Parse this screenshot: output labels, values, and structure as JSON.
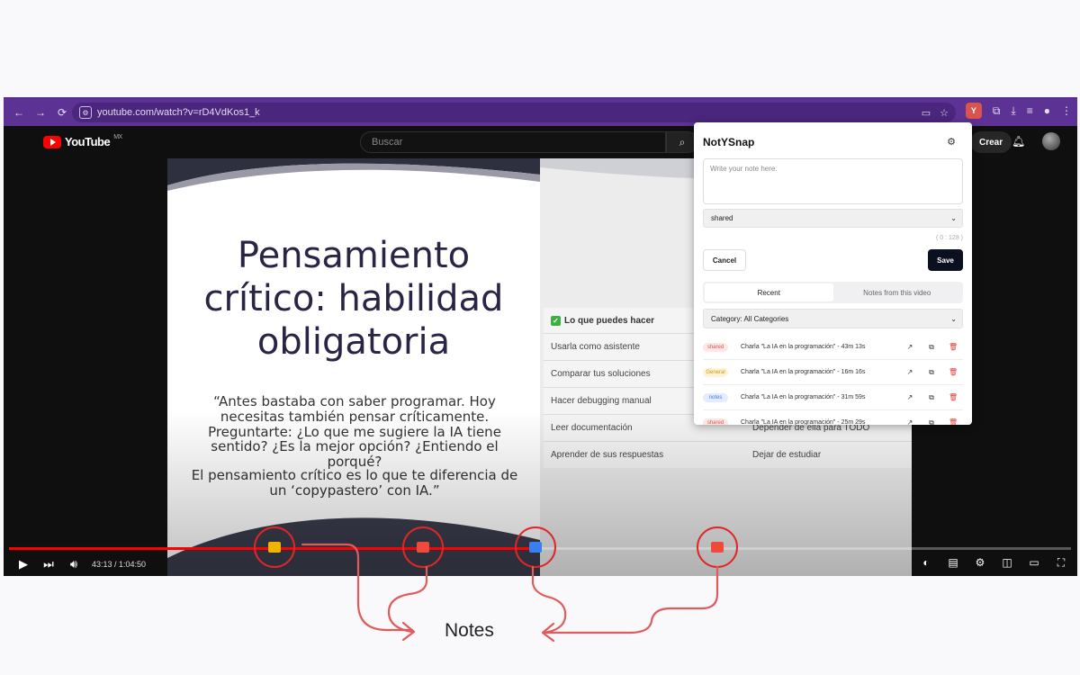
{
  "browser": {
    "url": "youtube.com/watch?v=rD4VdKos1_k",
    "extension_badge": "Y"
  },
  "youtube": {
    "logo_text": "YouTube",
    "region": "MX",
    "search_placeholder": "Buscar",
    "create_label": "Crear"
  },
  "slide": {
    "title": "Pensamiento crítico: habilidad obligatoria",
    "quote_1": "“Antes bastaba con saber programar. Hoy necesitas también pensar críticamente. Preguntarte: ¿Lo que me sugiere la IA tiene sentido? ¿Es la mejor opción? ¿Entiendo el porqué?",
    "quote_2": "El pensamiento crítico es lo que te diferencia de un ‘copypastero’ con IA.”",
    "list_header": "Lo que puedes hacer",
    "rows": [
      {
        "left": "Usarla como asistente",
        "right": ""
      },
      {
        "left": "Comparar tus soluciones",
        "right": ""
      },
      {
        "left": "Hacer debugging manual",
        "right": ""
      },
      {
        "left": "Leer documentación",
        "right": "Depender de ella para TODO"
      },
      {
        "left": "Aprender de sus respuestas",
        "right": "Dejar de estudiar"
      }
    ]
  },
  "player": {
    "time": "43:13 / 1:04:50",
    "progress_fraction": 0.5,
    "markers": [
      {
        "color": "#f0b400",
        "position_fraction": 0.25
      },
      {
        "color": "#f04a3c",
        "position_fraction": 0.39
      },
      {
        "color": "#3b7ef0",
        "position_fraction": 0.496
      },
      {
        "color": "#f04a3c",
        "position_fraction": 0.667
      }
    ]
  },
  "popup": {
    "title": "NotYSnap",
    "textarea_placeholder": "Write your note here.",
    "category_select": "shared",
    "counter": "( 0 : 128 )",
    "cancel_label": "Cancel",
    "save_label": "Save",
    "tab_recent": "Recent",
    "tab_video": "Notes from this video",
    "filter": "Category: All Categories",
    "notes": [
      {
        "badge": "shared",
        "badge_bg": "#fde7e7",
        "badge_fg": "#e0534a",
        "text": "Charla \"La IA en la programación\" - 43m 13s"
      },
      {
        "badge": "General",
        "badge_bg": "#fdf3d6",
        "badge_fg": "#d49a00",
        "text": "Charla \"La IA en la programación\" - 16m 16s"
      },
      {
        "badge": "notes",
        "badge_bg": "#e3edfd",
        "badge_fg": "#3b7ef0",
        "text": "Charla \"La IA en la programación\" - 31m 59s"
      },
      {
        "badge": "shared",
        "badge_bg": "#fde7e7",
        "badge_fg": "#e0534a",
        "text": "Charla \"La IA en la programación\" - 25m 29s"
      }
    ]
  },
  "annotation": {
    "label": "Notes",
    "ring_color": "#e02626",
    "arrow_color": "#e05b5b"
  }
}
